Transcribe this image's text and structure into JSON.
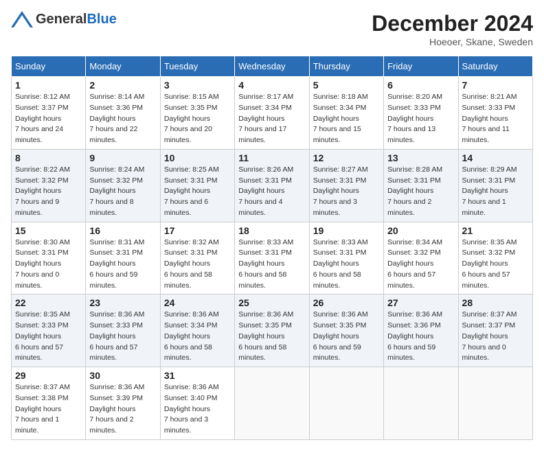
{
  "header": {
    "logo_general": "General",
    "logo_blue": "Blue",
    "month_title": "December 2024",
    "location": "Hoeoer, Skane, Sweden"
  },
  "days_of_week": [
    "Sunday",
    "Monday",
    "Tuesday",
    "Wednesday",
    "Thursday",
    "Friday",
    "Saturday"
  ],
  "weeks": [
    [
      {
        "day": 1,
        "sunrise": "8:12 AM",
        "sunset": "3:37 PM",
        "daylight": "7 hours and 24 minutes."
      },
      {
        "day": 2,
        "sunrise": "8:14 AM",
        "sunset": "3:36 PM",
        "daylight": "7 hours and 22 minutes."
      },
      {
        "day": 3,
        "sunrise": "8:15 AM",
        "sunset": "3:35 PM",
        "daylight": "7 hours and 20 minutes."
      },
      {
        "day": 4,
        "sunrise": "8:17 AM",
        "sunset": "3:34 PM",
        "daylight": "7 hours and 17 minutes."
      },
      {
        "day": 5,
        "sunrise": "8:18 AM",
        "sunset": "3:34 PM",
        "daylight": "7 hours and 15 minutes."
      },
      {
        "day": 6,
        "sunrise": "8:20 AM",
        "sunset": "3:33 PM",
        "daylight": "7 hours and 13 minutes."
      },
      {
        "day": 7,
        "sunrise": "8:21 AM",
        "sunset": "3:33 PM",
        "daylight": "7 hours and 11 minutes."
      }
    ],
    [
      {
        "day": 8,
        "sunrise": "8:22 AM",
        "sunset": "3:32 PM",
        "daylight": "7 hours and 9 minutes."
      },
      {
        "day": 9,
        "sunrise": "8:24 AM",
        "sunset": "3:32 PM",
        "daylight": "7 hours and 8 minutes."
      },
      {
        "day": 10,
        "sunrise": "8:25 AM",
        "sunset": "3:31 PM",
        "daylight": "7 hours and 6 minutes."
      },
      {
        "day": 11,
        "sunrise": "8:26 AM",
        "sunset": "3:31 PM",
        "daylight": "7 hours and 4 minutes."
      },
      {
        "day": 12,
        "sunrise": "8:27 AM",
        "sunset": "3:31 PM",
        "daylight": "7 hours and 3 minutes."
      },
      {
        "day": 13,
        "sunrise": "8:28 AM",
        "sunset": "3:31 PM",
        "daylight": "7 hours and 2 minutes."
      },
      {
        "day": 14,
        "sunrise": "8:29 AM",
        "sunset": "3:31 PM",
        "daylight": "7 hours and 1 minute."
      }
    ],
    [
      {
        "day": 15,
        "sunrise": "8:30 AM",
        "sunset": "3:31 PM",
        "daylight": "7 hours and 0 minutes."
      },
      {
        "day": 16,
        "sunrise": "8:31 AM",
        "sunset": "3:31 PM",
        "daylight": "6 hours and 59 minutes."
      },
      {
        "day": 17,
        "sunrise": "8:32 AM",
        "sunset": "3:31 PM",
        "daylight": "6 hours and 58 minutes."
      },
      {
        "day": 18,
        "sunrise": "8:33 AM",
        "sunset": "3:31 PM",
        "daylight": "6 hours and 58 minutes."
      },
      {
        "day": 19,
        "sunrise": "8:33 AM",
        "sunset": "3:31 PM",
        "daylight": "6 hours and 58 minutes."
      },
      {
        "day": 20,
        "sunrise": "8:34 AM",
        "sunset": "3:32 PM",
        "daylight": "6 hours and 57 minutes."
      },
      {
        "day": 21,
        "sunrise": "8:35 AM",
        "sunset": "3:32 PM",
        "daylight": "6 hours and 57 minutes."
      }
    ],
    [
      {
        "day": 22,
        "sunrise": "8:35 AM",
        "sunset": "3:33 PM",
        "daylight": "6 hours and 57 minutes."
      },
      {
        "day": 23,
        "sunrise": "8:36 AM",
        "sunset": "3:33 PM",
        "daylight": "6 hours and 57 minutes."
      },
      {
        "day": 24,
        "sunrise": "8:36 AM",
        "sunset": "3:34 PM",
        "daylight": "6 hours and 58 minutes."
      },
      {
        "day": 25,
        "sunrise": "8:36 AM",
        "sunset": "3:35 PM",
        "daylight": "6 hours and 58 minutes."
      },
      {
        "day": 26,
        "sunrise": "8:36 AM",
        "sunset": "3:35 PM",
        "daylight": "6 hours and 59 minutes."
      },
      {
        "day": 27,
        "sunrise": "8:36 AM",
        "sunset": "3:36 PM",
        "daylight": "6 hours and 59 minutes."
      },
      {
        "day": 28,
        "sunrise": "8:37 AM",
        "sunset": "3:37 PM",
        "daylight": "7 hours and 0 minutes."
      }
    ],
    [
      {
        "day": 29,
        "sunrise": "8:37 AM",
        "sunset": "3:38 PM",
        "daylight": "7 hours and 1 minute."
      },
      {
        "day": 30,
        "sunrise": "8:36 AM",
        "sunset": "3:39 PM",
        "daylight": "7 hours and 2 minutes."
      },
      {
        "day": 31,
        "sunrise": "8:36 AM",
        "sunset": "3:40 PM",
        "daylight": "7 hours and 3 minutes."
      },
      null,
      null,
      null,
      null
    ]
  ],
  "labels": {
    "sunrise": "Sunrise:",
    "sunset": "Sunset:",
    "daylight": "Daylight hours"
  }
}
